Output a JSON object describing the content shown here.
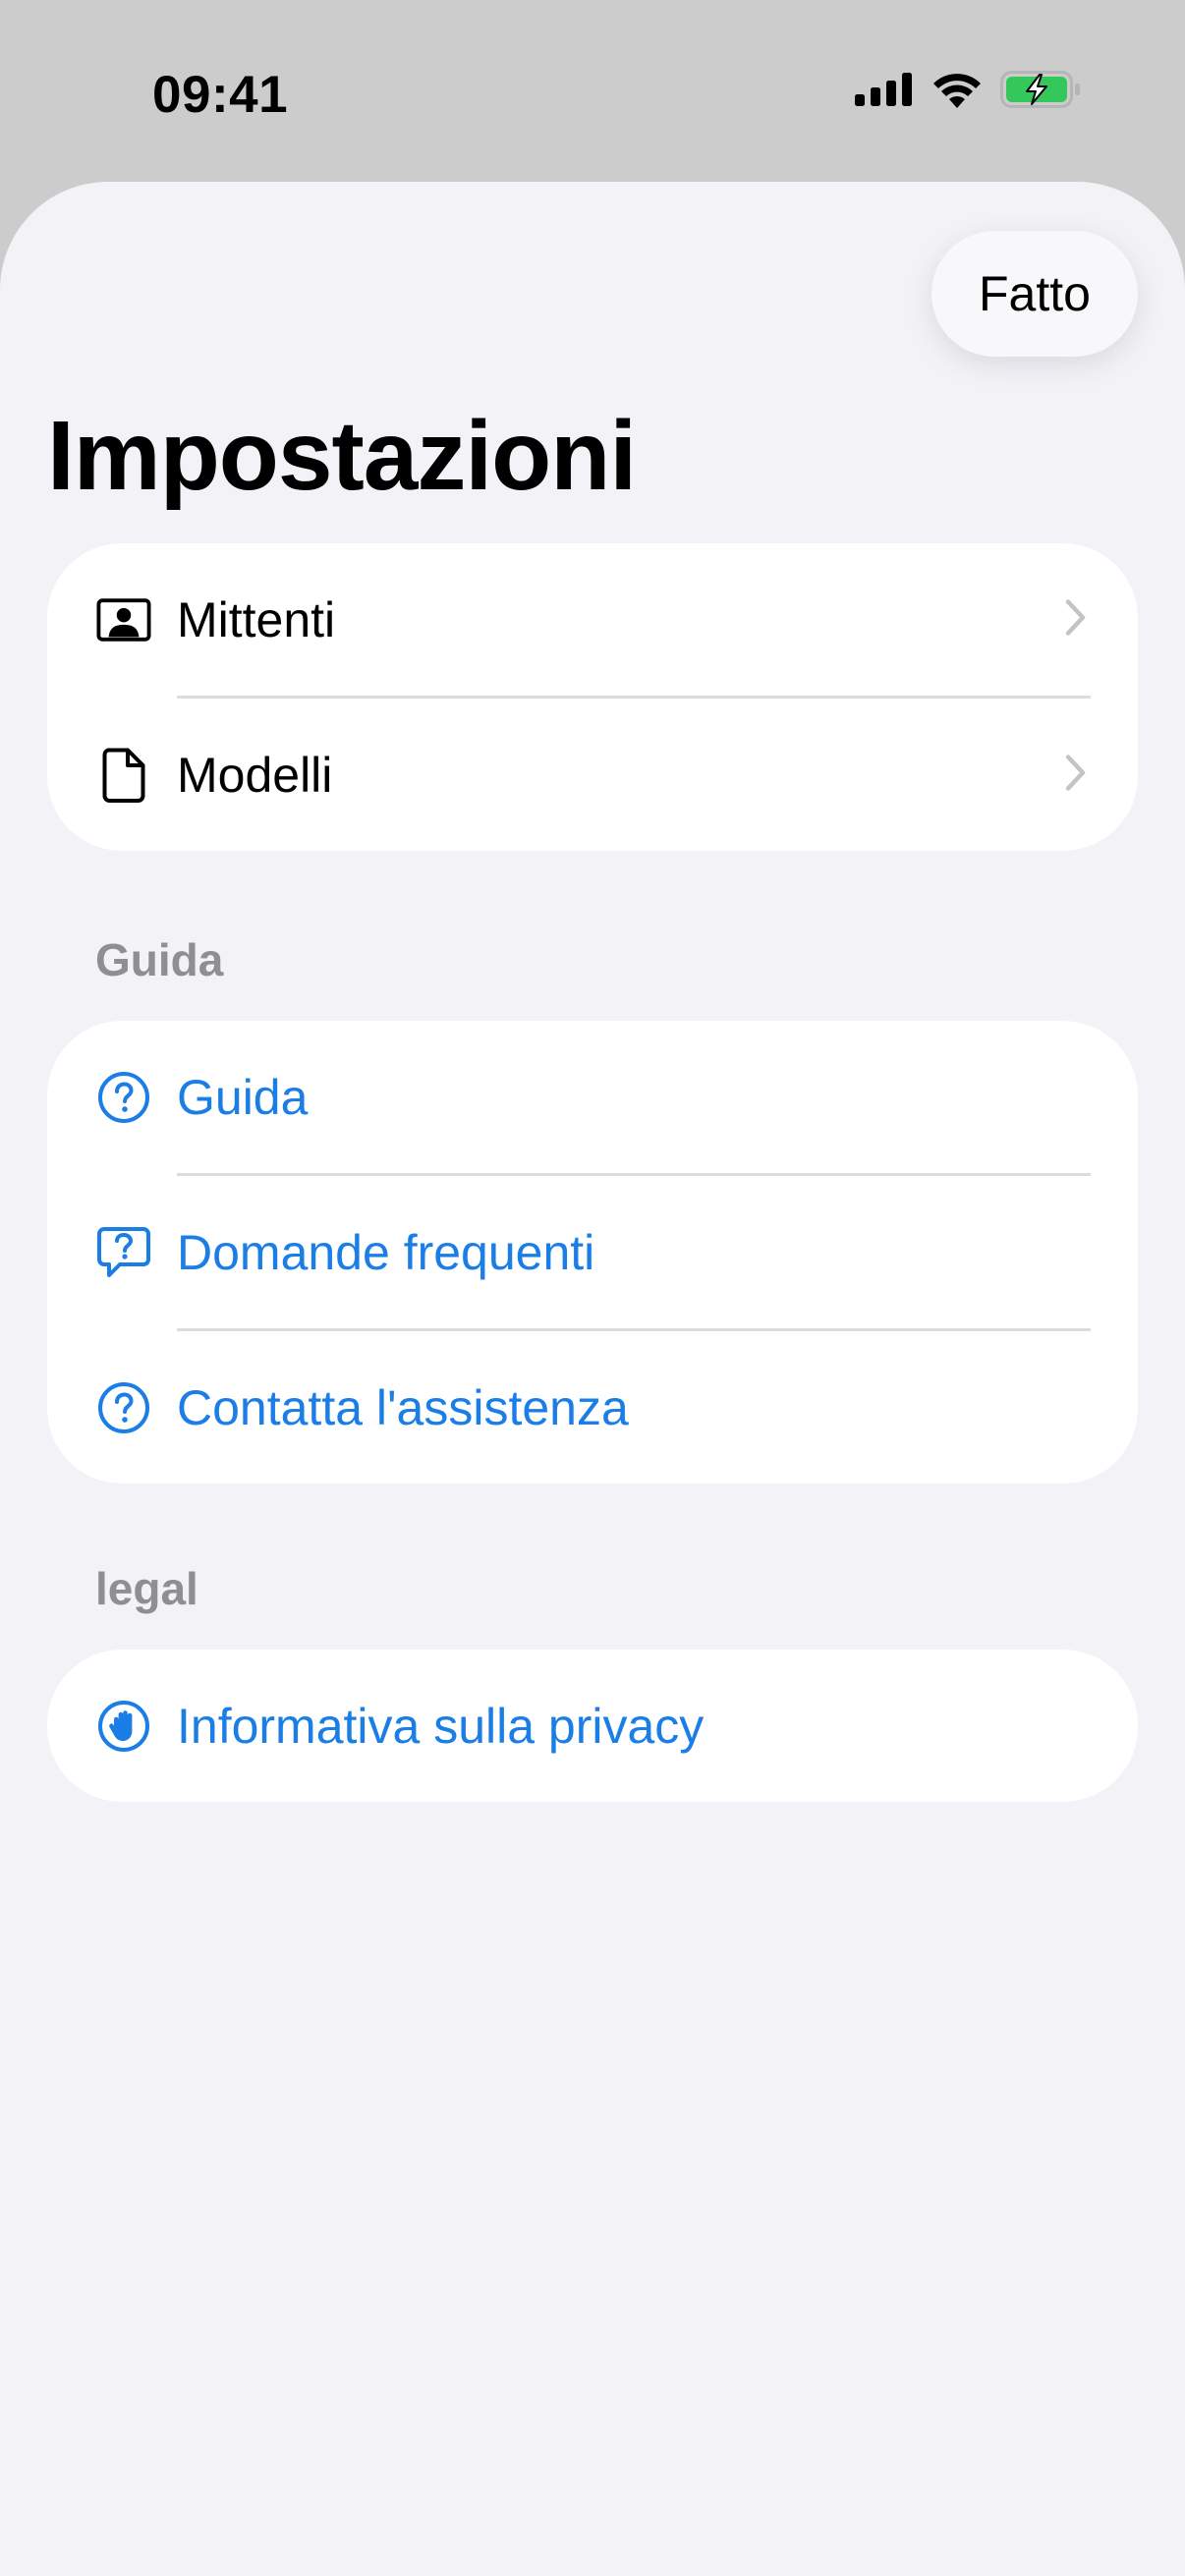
{
  "status_bar": {
    "time": "09:41",
    "icons": [
      "cellular-signal-icon",
      "wifi-icon",
      "battery-charging-icon"
    ],
    "battery_color": "#34c759"
  },
  "header": {
    "done_label": "Fatto",
    "title": "Impostazioni"
  },
  "main_section": {
    "items": [
      {
        "label": "Mittenti",
        "icon": "contact-card-icon"
      },
      {
        "label": "Modelli",
        "icon": "document-icon"
      }
    ]
  },
  "help_section": {
    "header": "Guida",
    "items": [
      {
        "label": "Guida",
        "icon": "question-circle-icon"
      },
      {
        "label": "Domande frequenti",
        "icon": "question-bubble-icon"
      },
      {
        "label": "Contatta l'assistenza",
        "icon": "question-circle-icon"
      }
    ]
  },
  "legal_section": {
    "header": "legal",
    "items": [
      {
        "label": "Informativa sulla privacy",
        "icon": "hand-raised-icon"
      }
    ]
  },
  "colors": {
    "accent": "#1a7ee6",
    "background": "#f2f2f7",
    "card": "#ffffff",
    "section_header": "#8e8e93"
  }
}
